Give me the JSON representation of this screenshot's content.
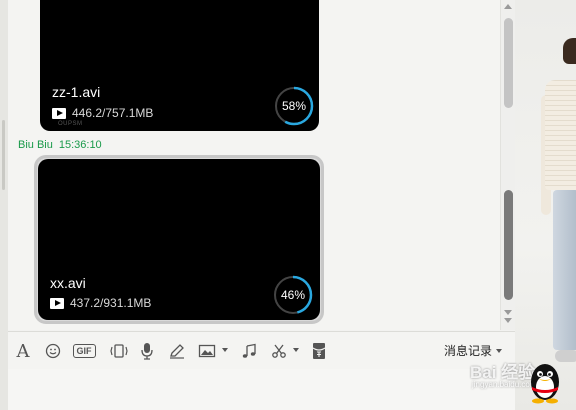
{
  "messages": [
    {
      "file_name": "zz-1.avi",
      "file_size": "446.2/757.1MB",
      "progress_label": "58%",
      "progress": 0.58,
      "watermark": "OUPSM"
    },
    {
      "file_name": "xx.avi",
      "file_size": "437.2/931.1MB",
      "progress_label": "46%",
      "progress": 0.46
    }
  ],
  "sender": {
    "name": "Biu Biu",
    "time": "15:36:10"
  },
  "toolbar": {
    "icons": [
      "font-icon",
      "emoji-icon",
      "gif-icon",
      "shake-icon",
      "voice-icon",
      "handwrite-icon",
      "image-icon",
      "music-icon",
      "screenshot-icon",
      "red-packet-icon"
    ],
    "gif_label": "GIF",
    "history_label": "消息记录"
  },
  "watermark": {
    "brand": "Bai 经验",
    "url": "jingyan.baidu.com"
  },
  "colors": {
    "accent": "#2aa8e0",
    "sender": "#1a9a4a",
    "card": "#000000"
  }
}
